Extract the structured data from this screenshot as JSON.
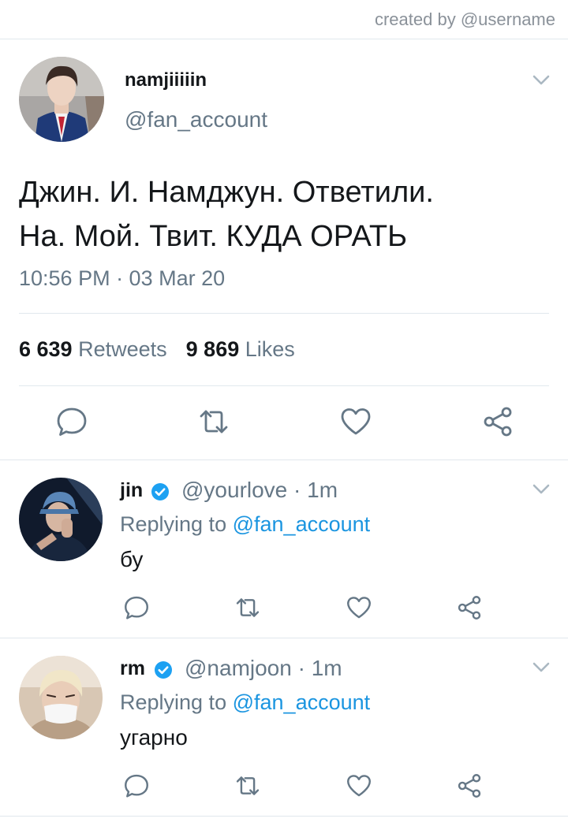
{
  "credit": "created by @username",
  "main_tweet": {
    "display_name": "namjiiiiin",
    "handle": "@fan_account",
    "text_line1": "Джин. И. Намджун. Ответили.",
    "text_line2": "На. Мой. Твит. КУДА ОРАТЬ",
    "timestamp": "10:56 PM · 03 Mar 20",
    "retweets_count": "6 639",
    "retweets_label": "Retweets",
    "likes_count": "9 869",
    "likes_label": "Likes",
    "actions": [
      "reply-icon",
      "retweet-icon",
      "like-icon",
      "share-icon"
    ]
  },
  "replies": [
    {
      "display_name": "jin",
      "verified": true,
      "handle_time": "@yourlove · 1m",
      "replying_prefix": "Replying to",
      "replying_mention": "@fan_account",
      "text": "бу"
    },
    {
      "display_name": "rm",
      "verified": true,
      "handle_time": "@namjoon · 1m",
      "replying_prefix": "Replying to",
      "replying_mention": "@fan_account",
      "text": "угарно"
    }
  ],
  "colors": {
    "link": "#1b95e0",
    "verified_badge": "#1da1f2",
    "secondary_text": "#657786",
    "divider": "#e1e8ed"
  }
}
